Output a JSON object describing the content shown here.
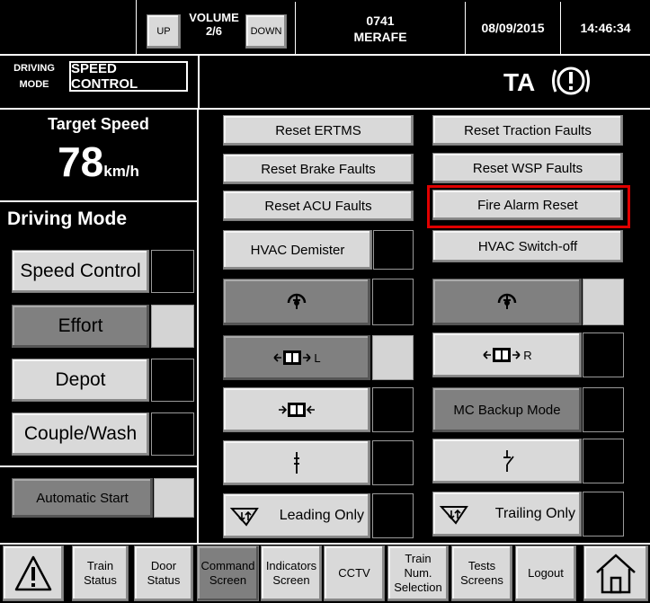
{
  "header": {
    "volume_up_label": "UP",
    "volume_title": "VOLUME",
    "volume_value": "2/6",
    "volume_down_label": "DOWN",
    "train_number": "0741",
    "station": "MERAFE",
    "date": "08/09/2015",
    "time": "14:46:34"
  },
  "mode_bar": {
    "driving_mode_label_line1": "DRIVING",
    "driving_mode_label_line2": "MODE",
    "current_mode": "SPEED CONTROL",
    "ta_label": "TA",
    "alert_symbol": "!"
  },
  "left_panel": {
    "target_speed_label": "Target Speed",
    "target_speed_value": "78",
    "target_speed_unit": "km/h",
    "driving_mode_title": "Driving Mode",
    "modes": [
      "Speed Control",
      "Effort",
      "Depot",
      "Couple/Wash"
    ],
    "automatic_start": "Automatic Start"
  },
  "controls": {
    "reset_ertms": "Reset ERTMS",
    "reset_traction": "Reset Traction Faults",
    "reset_brake": "Reset Brake Faults",
    "reset_wsp": "Reset WSP Faults",
    "reset_acu": "Reset ACU Faults",
    "fire_alarm_reset": "Fire Alarm Reset",
    "hvac_demister": "HVAC Demister",
    "hvac_switch_off": "HVAC Switch-off",
    "door_left_suffix": "L",
    "door_right_suffix": "R",
    "mc_backup_mode": "MC Backup Mode",
    "leading_only": "Leading Only",
    "trailing_only": "Trailing Only"
  },
  "nav": {
    "items": [
      {
        "line1": "Train",
        "line2": "Status"
      },
      {
        "line1": "Door",
        "line2": "Status"
      },
      {
        "line1": "Command",
        "line2": "Screen"
      },
      {
        "line1": "Indicators",
        "line2": "Screen"
      },
      {
        "line1": "CCTV",
        "line2": ""
      },
      {
        "line1": "Train",
        "line2": "Num.",
        "line3": "Selection"
      },
      {
        "line1": "Tests",
        "line2": "Screens"
      },
      {
        "line1": "Logout",
        "line2": ""
      }
    ]
  },
  "colors": {
    "highlight": "#e00000",
    "button_face": "#d9d9d9",
    "button_dark": "#808080",
    "background": "#000000"
  },
  "icons": [
    "warning-icon",
    "home-icon",
    "pantograph-up-icon",
    "door-icon",
    "coupler-icon",
    "circuit-breaker-icon"
  ]
}
